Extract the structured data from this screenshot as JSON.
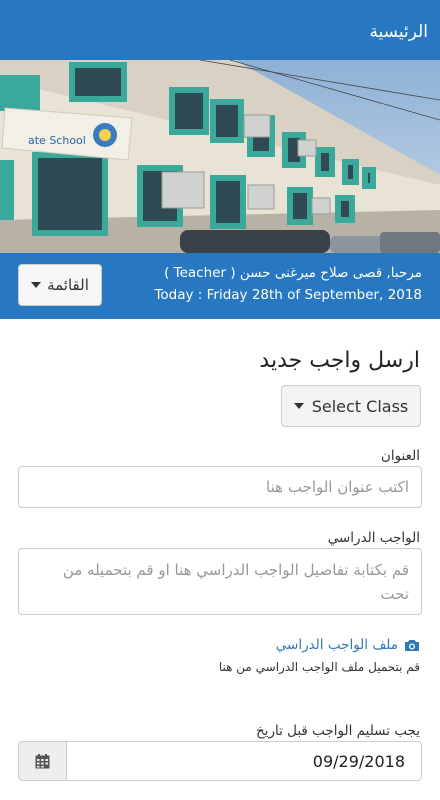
{
  "header": {
    "title": "الرئيسية"
  },
  "hero": {
    "sign_text": "ate School"
  },
  "info": {
    "menu_label": "القائمة",
    "greeting": "مرحبا, قصى صلاح ميرغنى حسن ( Teacher )",
    "today": "Today : Friday 28th of September, 2018"
  },
  "form": {
    "title": "ارسل واجب جديد",
    "select_class_label": "Select Class",
    "title_field": {
      "label": "العنوان",
      "placeholder": "اكتب عنوان الواجب هنا"
    },
    "homework_field": {
      "label": "الواجب الدراسي",
      "placeholder_line1": "قم بكتابة تفاصيل الواجب الدراسي هنا او قم بتحميله من",
      "placeholder_line2": "تحت"
    },
    "file": {
      "link_label": "ملف الواجب الدراسي",
      "hint": "قم بتحميل ملف الواجب الدراسي من هنا"
    },
    "due_date": {
      "label": "يجب تسليم الواجب قبل تاريخ",
      "value": "09/29/2018"
    }
  },
  "colors": {
    "primary": "#2877c1",
    "link": "#2f77b7",
    "wall": "#e9e3d6",
    "window_frame": "#3aa89a"
  },
  "icons": {
    "menu_caret": "caret-down-icon",
    "select_caret": "caret-down-icon",
    "file": "camera-icon",
    "date": "calendar-icon"
  }
}
